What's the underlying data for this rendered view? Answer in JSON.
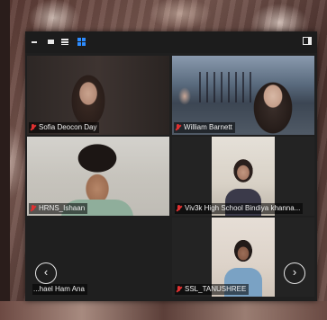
{
  "toolbar": {
    "view_icons": [
      "minimize-icon",
      "small-view-icon",
      "list-view-icon",
      "gallery-view-icon"
    ],
    "active_view": "gallery-view-icon",
    "side_icon": "side-panel-icon"
  },
  "participants": [
    {
      "name": "Sofia Deocon Day",
      "muted": true
    },
    {
      "name": "William Barnett",
      "muted": true
    },
    {
      "name": "HRNS_Ishaan",
      "muted": true
    },
    {
      "name": "Viv3k High School Bindiya khanna...",
      "muted": true
    },
    {
      "name": "...hael Ham Ana",
      "muted": false
    },
    {
      "name": "SSL_TANUSHREE",
      "muted": true
    }
  ],
  "navigation": {
    "prev_glyph": "‹",
    "next_glyph": "›"
  },
  "colors": {
    "accent": "#2d8cff",
    "muted_mic": "#e03131",
    "window_bg": "#1f1f1f"
  }
}
